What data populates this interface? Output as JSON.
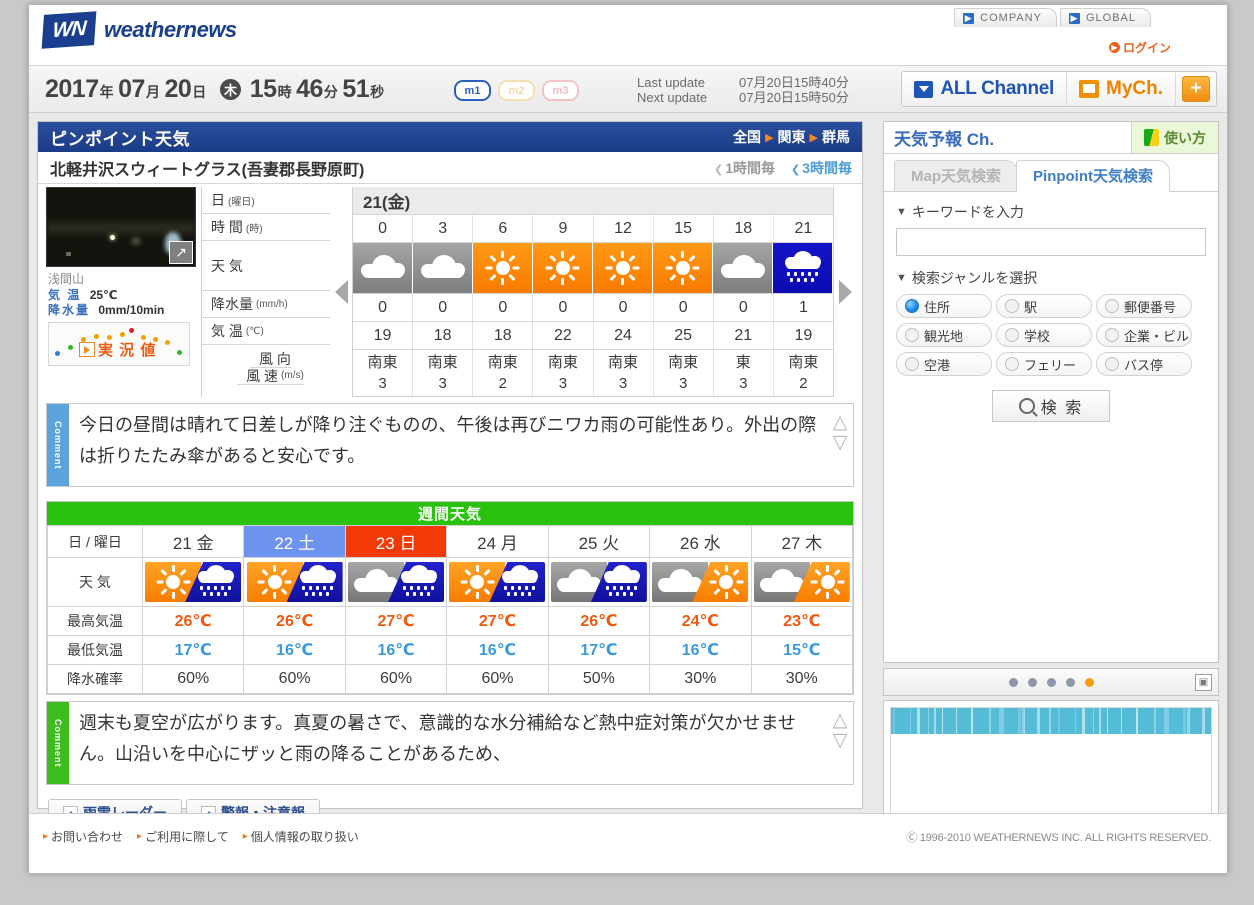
{
  "header": {
    "logo_text": "weathernews",
    "logo_mark": "WN",
    "corp_tabs": [
      {
        "label": "COMPANY",
        "icon": "external-link-icon"
      },
      {
        "label": "GLOBAL",
        "icon": "external-link-icon"
      }
    ],
    "login": "ログイン"
  },
  "datebar": {
    "year": "2017",
    "year_unit": "年",
    "month": "07",
    "month_unit": "月",
    "day": "20",
    "day_unit": "日",
    "weekday_icon": "木",
    "hour": "15",
    "hour_unit": "時",
    "minute": "46",
    "minute_unit": "分",
    "second": "51",
    "second_unit": "秒",
    "mode_badges": [
      "m1",
      "m2",
      "m3"
    ],
    "last_update_label": "Last update",
    "last_update_value": "07月20日15時40分",
    "next_update_label": "Next update",
    "next_update_value": "07月20日15時50分",
    "all_channel": "ALL Channel",
    "my_channel": "MyCh.",
    "plus": "+"
  },
  "pinpoint": {
    "title": "ピンポイント天気",
    "breadcrumb": [
      "全国",
      "関東",
      "群馬"
    ],
    "location": "北軽井沢スウィートグラス(吾妻郡長野原町)",
    "hourly_links": [
      {
        "label": "1時間毎",
        "active": false
      },
      {
        "label": "3時間毎",
        "active": true
      }
    ]
  },
  "observation": {
    "station": "浅間山",
    "temp_label": "気 温",
    "temp_value": "25℃",
    "precip_label": "降水量",
    "precip_value": "0mm/10min",
    "button_label": "実 況 値",
    "expand_icon": "expand-icon"
  },
  "hourly": {
    "row_labels": [
      {
        "main": "日",
        "sub": "(曜日)"
      },
      {
        "main": "時 間",
        "sub": "(時)"
      },
      {
        "main": "天 気",
        "sub": ""
      },
      {
        "main": "降水量",
        "sub": "(mm/h)"
      },
      {
        "main": "気 温",
        "sub": "(℃)"
      },
      {
        "main": "風 向",
        "sub": ""
      },
      {
        "main": "風 速",
        "sub": "(m/s)"
      }
    ],
    "day": "21(金)",
    "times": [
      "0",
      "3",
      "6",
      "9",
      "12",
      "15",
      "18",
      "21"
    ],
    "icons": [
      "cloud",
      "cloud",
      "sun",
      "sun",
      "sun",
      "sun",
      "cloud",
      "rain"
    ],
    "precip": [
      "0",
      "0",
      "0",
      "0",
      "0",
      "0",
      "0",
      "1"
    ],
    "temp": [
      "19",
      "18",
      "18",
      "22",
      "24",
      "25",
      "21",
      "19"
    ],
    "wind_dir": [
      "南東",
      "南東",
      "南東",
      "南東",
      "南東",
      "南東",
      "東",
      "南東"
    ],
    "wind_spd": [
      "3",
      "3",
      "2",
      "3",
      "3",
      "3",
      "3",
      "2"
    ],
    "prev_icon": "arrow-left-icon",
    "next_icon": "arrow-right-icon"
  },
  "comment_today": {
    "tab": "Comment",
    "text": "今日の昼間は晴れて日差しが降り注ぐものの、午後は再びニワカ雨の可能性あり。外出の際は折りたたみ傘があると安心です。"
  },
  "weekly": {
    "title": "週間天気",
    "row_labels": [
      "日 / 曜日",
      "天 気",
      "最高気温",
      "最低気温",
      "降水確率"
    ],
    "days": [
      {
        "label": "21 金",
        "kind": "normal"
      },
      {
        "label": "22 土",
        "kind": "sat"
      },
      {
        "label": "23 日",
        "kind": "sun"
      },
      {
        "label": "24 月",
        "kind": "normal"
      },
      {
        "label": "25 火",
        "kind": "normal"
      },
      {
        "label": "26 水",
        "kind": "normal"
      },
      {
        "label": "27 木",
        "kind": "normal"
      }
    ],
    "icons": [
      {
        "left": "sun",
        "right": "rain"
      },
      {
        "left": "sun",
        "right": "rain"
      },
      {
        "left": "cloud",
        "right": "rain"
      },
      {
        "left": "sun",
        "right": "rain"
      },
      {
        "left": "cloud",
        "right": "rain"
      },
      {
        "left": "cloud",
        "right": "sun"
      },
      {
        "left": "cloud",
        "right": "sun"
      }
    ],
    "high": [
      "26℃",
      "26℃",
      "27℃",
      "27℃",
      "26℃",
      "24℃",
      "23℃"
    ],
    "low": [
      "17℃",
      "16℃",
      "16℃",
      "16℃",
      "17℃",
      "16℃",
      "15℃"
    ],
    "pop": [
      "60%",
      "60%",
      "60%",
      "60%",
      "50%",
      "30%",
      "30%"
    ]
  },
  "comment_week": {
    "tab": "Comment",
    "text": "週末も夏空が広がります。真夏の暑さで、意識的な水分補給など熱中症対策が欠かせません。山沿いを中心にザッと雨の降ることがあるため、"
  },
  "bottom_tabs": [
    {
      "label": "雨雲レーダー"
    },
    {
      "label": "警報・注意報"
    }
  ],
  "sidebar": {
    "title": "天気予報 Ch.",
    "howto": "使い方",
    "tabs": [
      {
        "label": "Map天気検索",
        "active": false
      },
      {
        "label": "Pinpoint天気検索",
        "active": true
      }
    ],
    "keyword_section": "キーワードを入力",
    "keyword_value": "",
    "keyword_placeholder": "",
    "genre_section": "検索ジャンルを選択",
    "genres": [
      {
        "label": "住所",
        "selected": true
      },
      {
        "label": "駅",
        "selected": false
      },
      {
        "label": "郵便番号",
        "selected": false
      },
      {
        "label": "観光地",
        "selected": false
      },
      {
        "label": "学校",
        "selected": false
      },
      {
        "label": "企業・ビル",
        "selected": false
      },
      {
        "label": "空港",
        "selected": false
      },
      {
        "label": "フェリー",
        "selected": false
      },
      {
        "label": "バス停",
        "selected": false
      }
    ],
    "search_button": "検 索",
    "carousel_dots": 5,
    "carousel_active_index": 4,
    "close_icon": "close-icon"
  },
  "footer": {
    "links": [
      "お問い合わせ",
      "ご利用に際して",
      "個人情報の取り扱い"
    ],
    "copyright": "Ⓒ 1996-2010 WEATHERNEWS INC. ALL RIGHTS RESERVED."
  },
  "colors": {
    "brand_blue": "#1a3f8f",
    "accent_orange": "#f08200",
    "sun": "#f97a00",
    "cloud": "#7d7d7d",
    "rain": "#1414c8",
    "week_header_green": "#2bc20f",
    "saturday": "#6c93ee",
    "sunday": "#f23a08"
  }
}
